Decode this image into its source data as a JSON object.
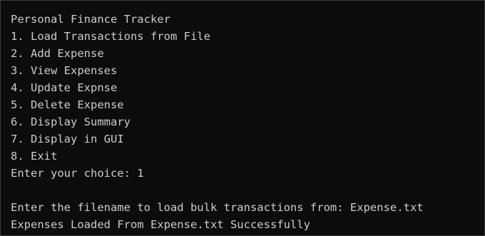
{
  "terminal": {
    "lines": {
      "title": "Personal Finance Tracker",
      "menu_1": "1. Load Transactions from File",
      "menu_2": "2. Add Expense",
      "menu_3": "3. View Expenses",
      "menu_4": "4. Update Expnse",
      "menu_5": "5. Delete Expense",
      "menu_6": "6. Display Summary",
      "menu_7": "7. Display in GUI",
      "menu_8": "8. Exit",
      "prompt_choice": "Enter your choice: 1",
      "prompt_filename": "Enter the filename to load bulk transactions from: Expense.txt",
      "status": "Expenses Loaded From Expense.txt Successfully"
    }
  },
  "colors": {
    "background": "#0c0c0c",
    "text": "#cccccc",
    "border": "#3c3c3c"
  }
}
